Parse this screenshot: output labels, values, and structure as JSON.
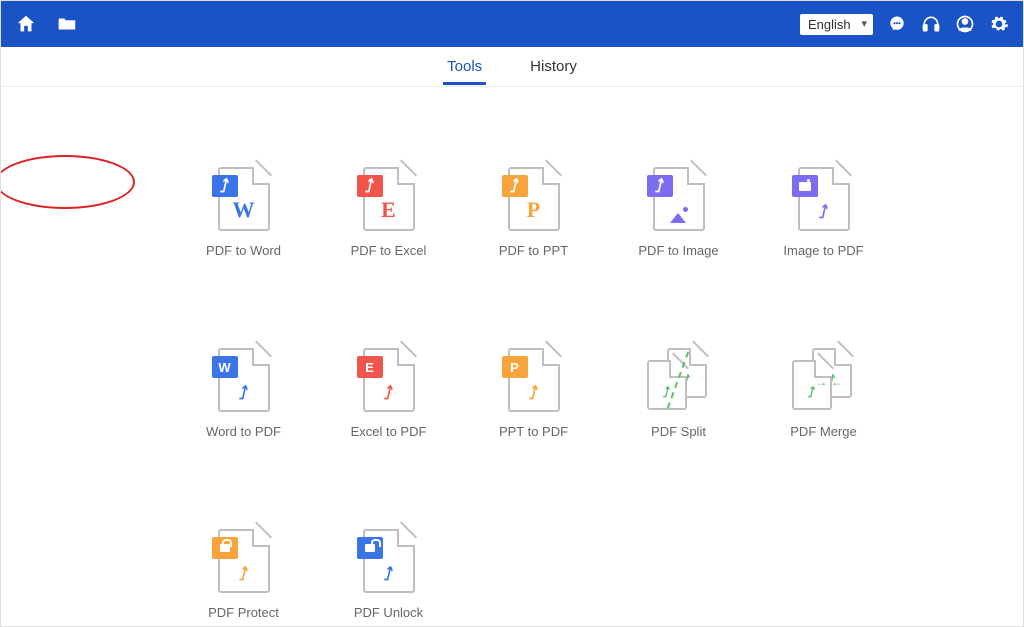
{
  "header": {
    "language_selected": "English"
  },
  "tabs": {
    "tools": "Tools",
    "history": "History",
    "active": "tools"
  },
  "tools": {
    "pdf_to_word": {
      "label": "PDF to Word"
    },
    "pdf_to_excel": {
      "label": "PDF to Excel"
    },
    "pdf_to_ppt": {
      "label": "PDF to PPT"
    },
    "pdf_to_image": {
      "label": "PDF to Image"
    },
    "image_to_pdf": {
      "label": "Image to PDF"
    },
    "word_to_pdf": {
      "label": "Word to PDF"
    },
    "excel_to_pdf": {
      "label": "Excel to PDF"
    },
    "ppt_to_pdf": {
      "label": "PPT to PDF"
    },
    "pdf_split": {
      "label": "PDF Split"
    },
    "pdf_merge": {
      "label": "PDF Merge"
    },
    "pdf_protect": {
      "label": "PDF Protect"
    },
    "pdf_unlock": {
      "label": "PDF Unlock"
    }
  },
  "badges": {
    "pdf": "↓",
    "word": "W",
    "excel": "E",
    "ppt": "P"
  },
  "annotation": {
    "highlighted_tool": "pdf_to_word"
  }
}
